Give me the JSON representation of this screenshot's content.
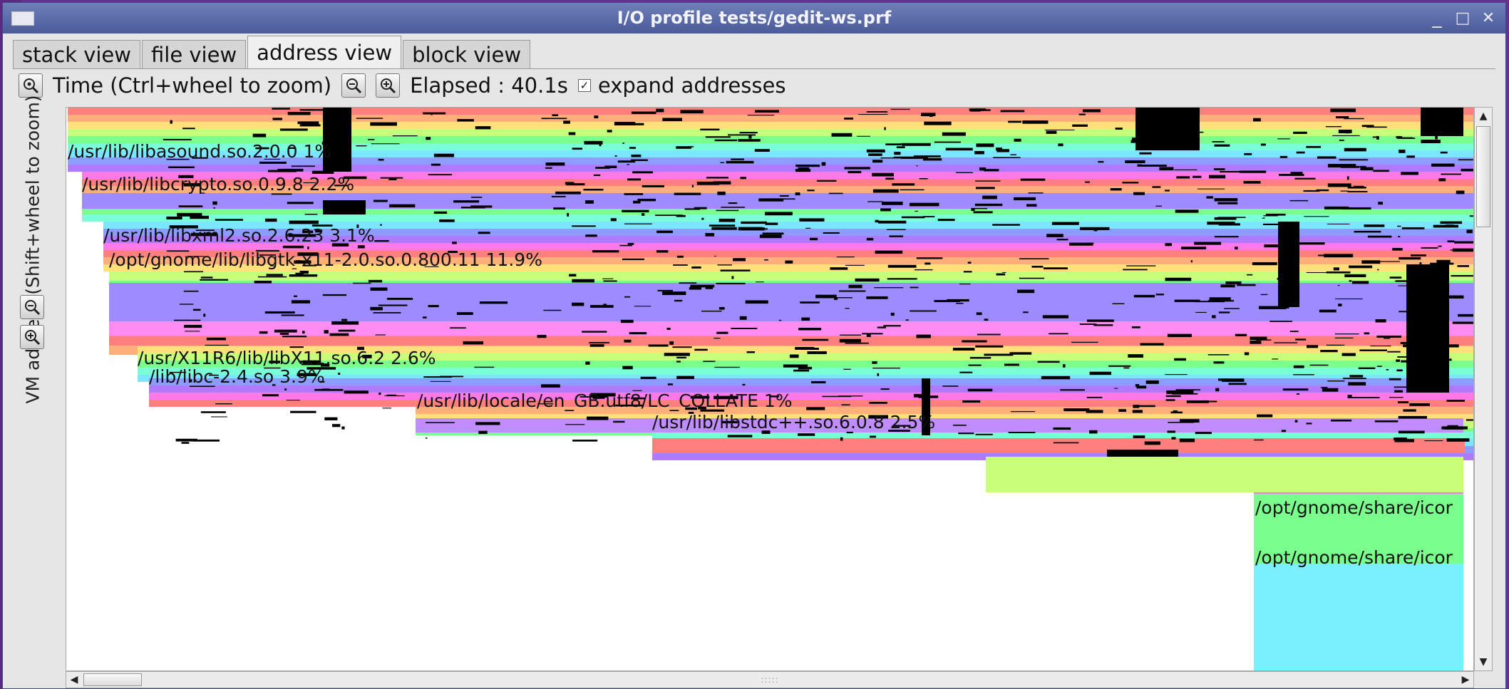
{
  "window": {
    "title": "I/O profile tests/gedit-ws.prf",
    "controls": {
      "minimize": "_",
      "maximize": "□",
      "close": "✕"
    }
  },
  "tabs": [
    {
      "label": "stack view",
      "active": false
    },
    {
      "label": "file view",
      "active": false
    },
    {
      "label": "address view",
      "active": true
    },
    {
      "label": "block view",
      "active": false
    }
  ],
  "toolbar": {
    "time_label": "Time (Ctrl+wheel to zoom)",
    "elapsed_label": "Elapsed : 40.1s",
    "expand_label": "expand addresses",
    "expand_checked": true,
    "check_glyph": "✓"
  },
  "vertical_axis_label": "VM address (Shift+wheel to zoom)",
  "icons": {
    "zoom_fit": "zoom-fit-icon",
    "zoom_out": "zoom-out-icon",
    "zoom_in": "zoom-in-icon"
  },
  "colors": {
    "band_cycle": [
      "#ff7f7f",
      "#ffb07a",
      "#ffe07a",
      "#c8ff7a",
      "#7aff8c",
      "#7affd6",
      "#7ae6ff",
      "#8c9cff",
      "#b07aff",
      "#ff7ae6"
    ],
    "title_bar": "#4a5a9a",
    "desktop": "#6a2f8e"
  },
  "mappings": [
    {
      "label": "/usr/lib/libasound.so.2.0.0 1%"
    },
    {
      "label": "/usr/lib/libcrypto.so.0.9.8 2.2%"
    },
    {
      "label": "/usr/lib/libxml2.so.2.6.23 3.1%"
    },
    {
      "label": "/opt/gnome/lib/libgtk-x11-2.0.so.0.800.11 11.9%"
    },
    {
      "label": "/usr/X11R6/lib/libX11.so.6.2 2.6%"
    },
    {
      "label": "/lib/libc-2.4.so 3.9%"
    },
    {
      "label": "/usr/lib/locale/en_GB.utf8/LC_COLLATE 1%"
    },
    {
      "label": "/usr/lib/libstdc++.so.6.0.8 2.5%"
    },
    {
      "label": "/opt/gnome/share/icor"
    },
    {
      "label": "/opt/gnome/share/icor"
    }
  ]
}
